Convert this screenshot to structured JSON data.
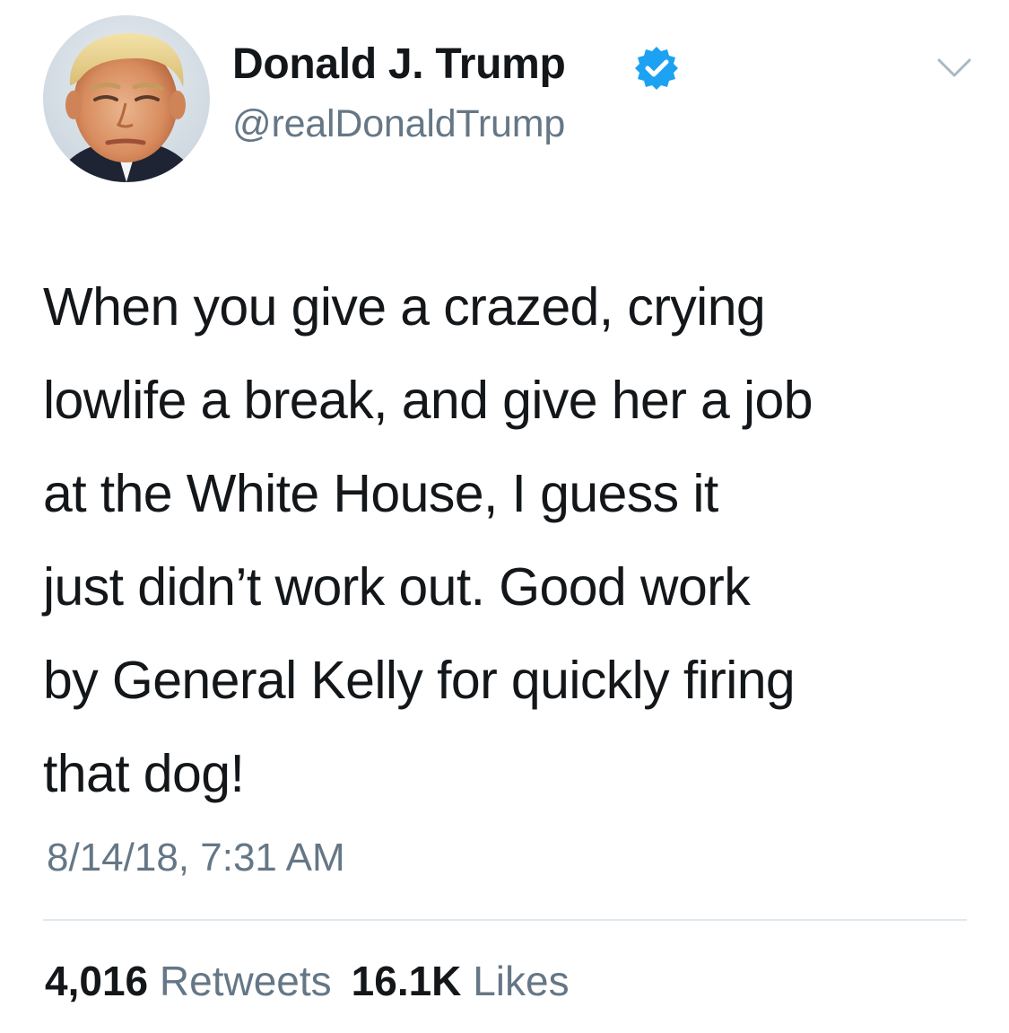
{
  "colors": {
    "text_primary": "#14171a",
    "text_secondary": "#657786",
    "verified_blue": "#1da1f2",
    "divider": "#e1e8ed"
  },
  "user": {
    "display_name": "Donald J. Trump",
    "handle": "@realDonaldTrump",
    "verified": true,
    "verified_icon": "verified-badge-icon",
    "avatar_icon": "profile-photo"
  },
  "menu_icon": "chevron-down-icon",
  "tweet": {
    "lines": [
      "When you give a crazed, crying",
      "lowlife a break, and give her a job",
      "at the White House, I guess it",
      "just didn’t work out. Good work",
      "by General Kelly for quickly firing",
      "that dog!"
    ],
    "timestamp": "8/14/18, 7:31 AM"
  },
  "stats": {
    "retweets_count": "4,016",
    "retweets_label": "Retweets",
    "likes_count": "16.1K",
    "likes_label": "Likes"
  }
}
